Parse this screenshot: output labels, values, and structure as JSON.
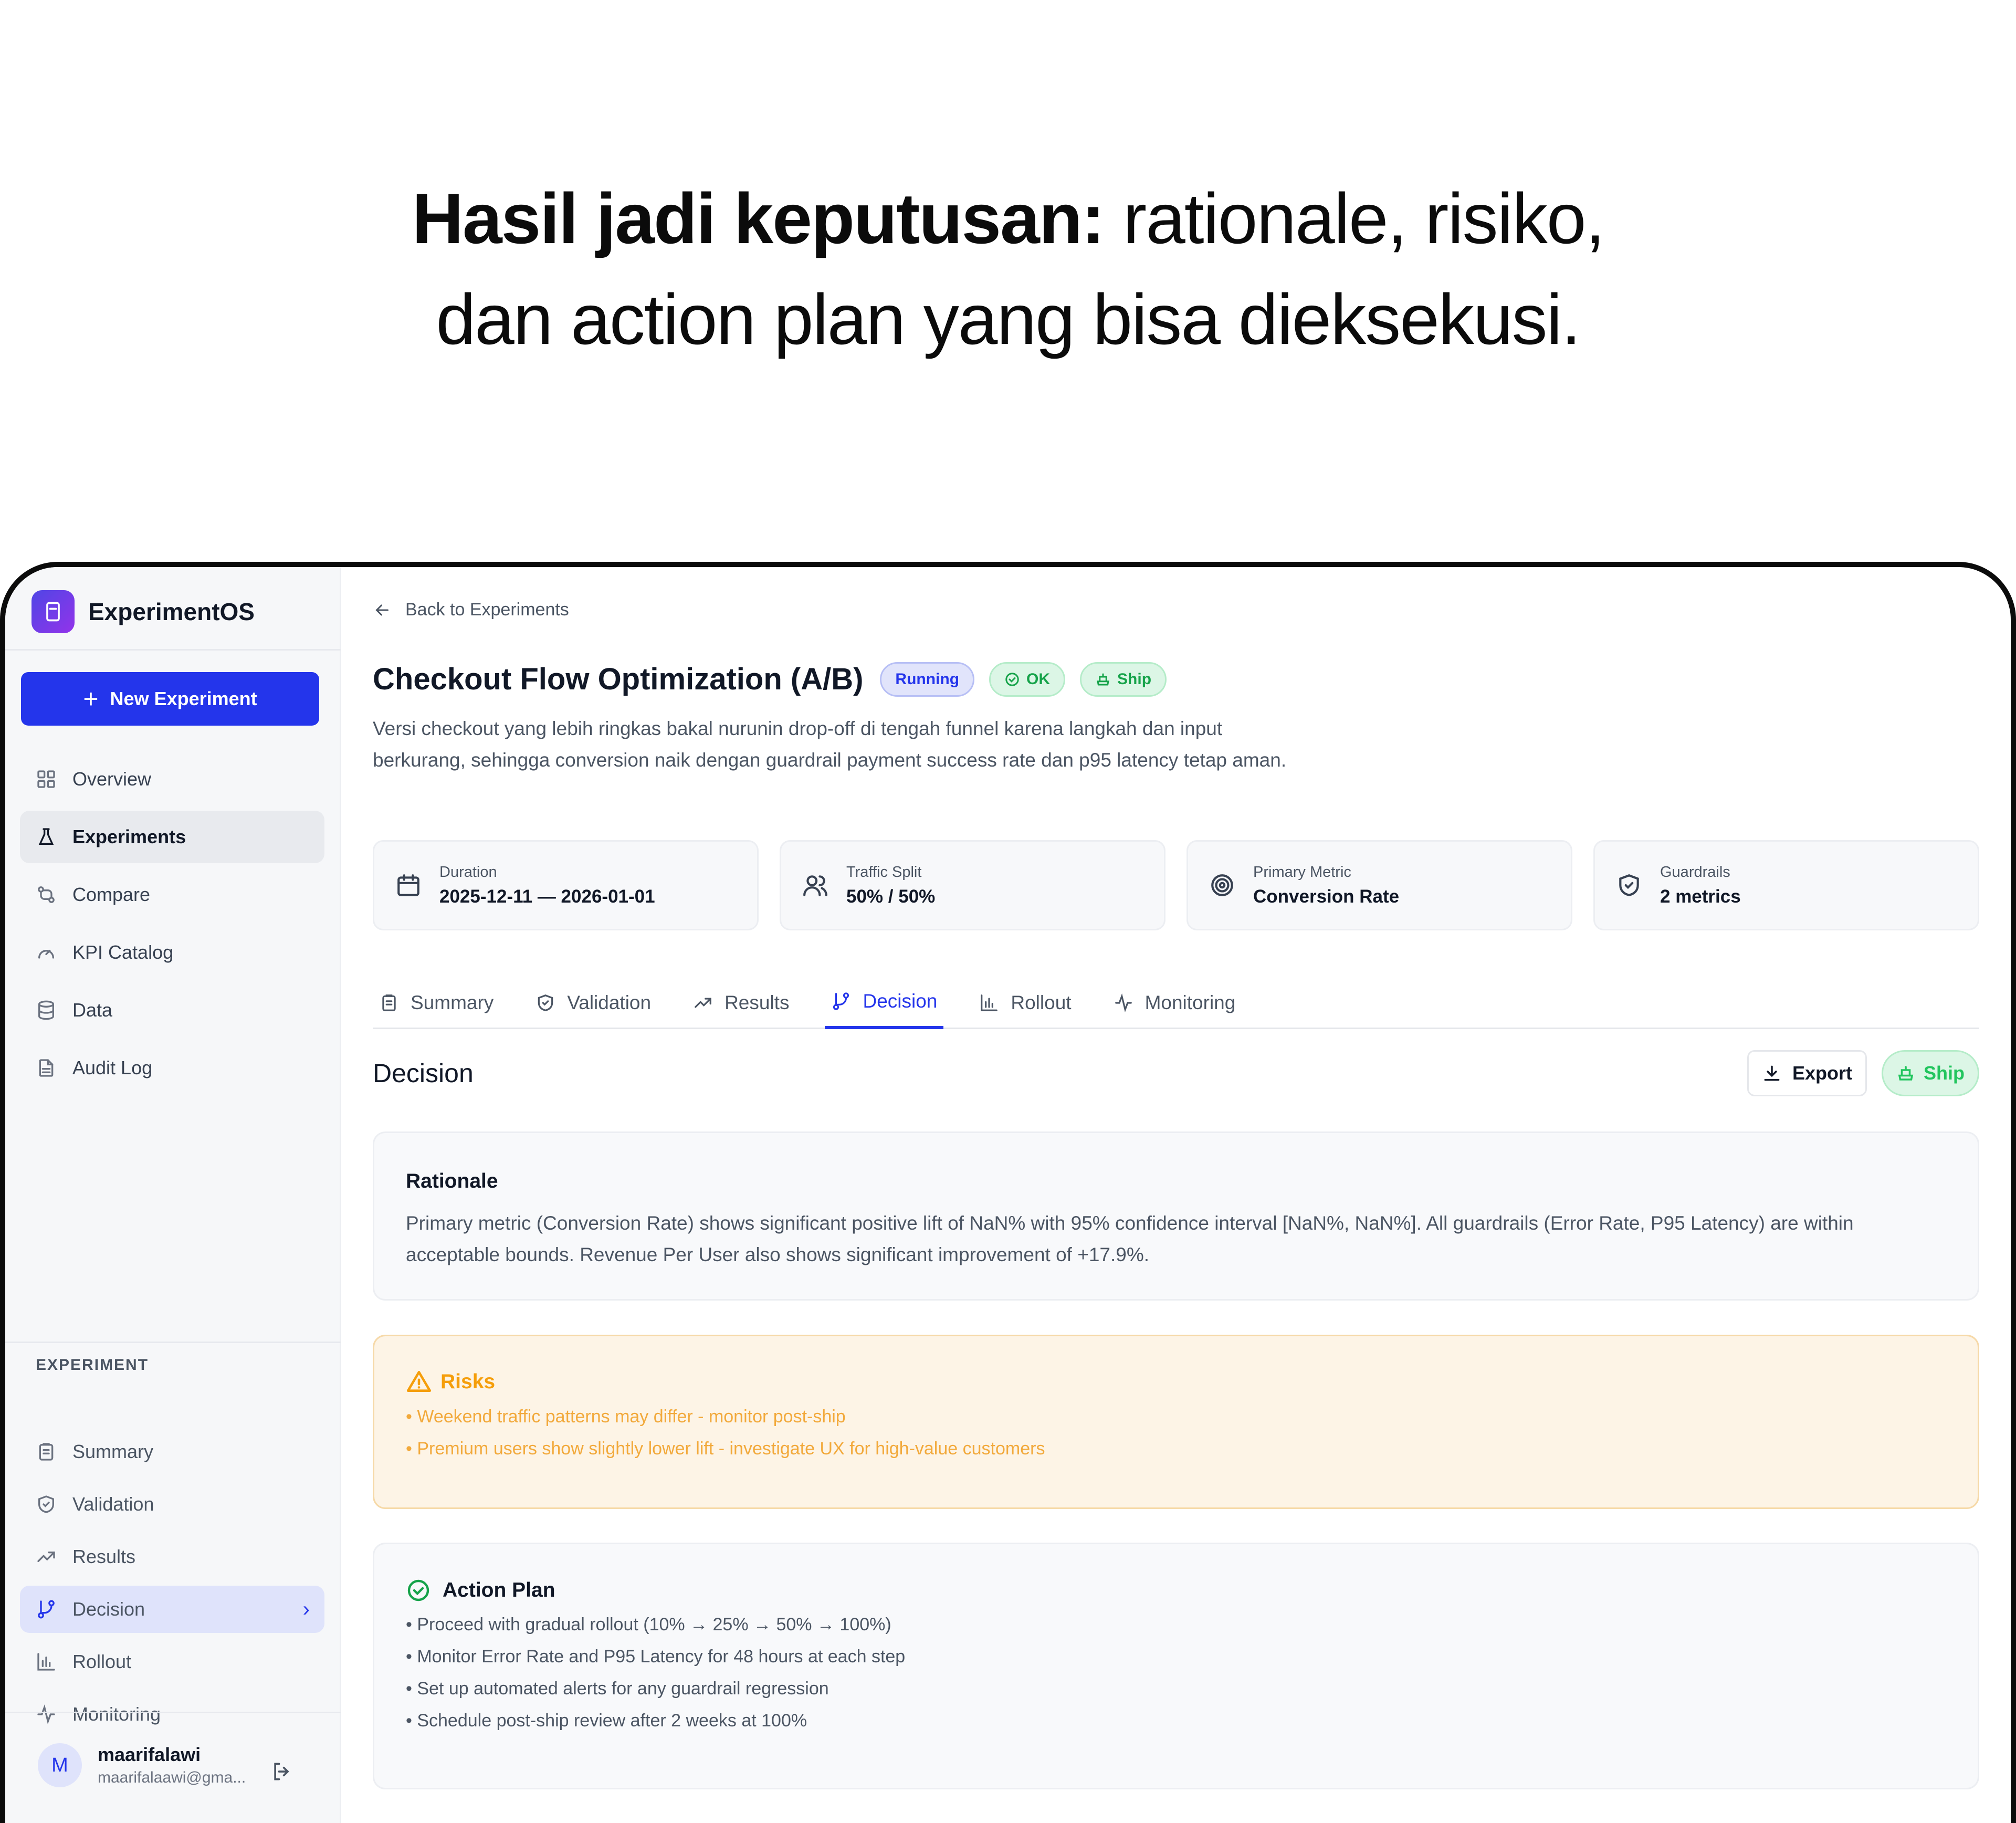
{
  "headline": {
    "bold": "Hasil jadi keputusan:",
    "line1_rest": " rationale, risiko,",
    "line2": "dan action plan yang bisa dieksekusi."
  },
  "sidebar": {
    "brand": "ExperimentOS",
    "new_button": "New Experiment",
    "nav": [
      {
        "label": "Overview",
        "icon": "grid-icon"
      },
      {
        "label": "Experiments",
        "icon": "flask-icon"
      },
      {
        "label": "Compare",
        "icon": "compare-icon"
      },
      {
        "label": "KPI Catalog",
        "icon": "gauge-icon"
      },
      {
        "label": "Data",
        "icon": "database-icon"
      },
      {
        "label": "Audit Log",
        "icon": "document-icon"
      }
    ],
    "section_label": "EXPERIMENT",
    "experiment_nav": [
      {
        "label": "Summary",
        "icon": "clipboard-icon"
      },
      {
        "label": "Validation",
        "icon": "shield-check-icon"
      },
      {
        "label": "Results",
        "icon": "trend-up-icon"
      },
      {
        "label": "Decision",
        "icon": "git-branch-icon"
      },
      {
        "label": "Rollout",
        "icon": "bar-chart-icon"
      },
      {
        "label": "Monitoring",
        "icon": "activity-icon"
      }
    ],
    "user": {
      "initial": "M",
      "name": "maarifalawi",
      "email": "maarifalaawi@gma..."
    }
  },
  "main": {
    "back_label": "Back to Experiments",
    "title": "Checkout Flow Optimization (A/B)",
    "badges": {
      "running": "Running",
      "ok": "OK",
      "ship": "Ship"
    },
    "description": "Versi checkout yang lebih ringkas bakal nurunin drop-off di tengah funnel karena langkah dan input berkurang, sehingga conversion naik dengan guardrail payment success rate dan p95 latency tetap aman.",
    "stats": [
      {
        "label": "Duration",
        "value": "2025-12-11 — 2026-01-01",
        "icon": "calendar-icon"
      },
      {
        "label": "Traffic Split",
        "value": "50% / 50%",
        "icon": "users-icon"
      },
      {
        "label": "Primary Metric",
        "value": "Conversion Rate",
        "icon": "target-icon"
      },
      {
        "label": "Guardrails",
        "value": "2 metrics",
        "icon": "shield-icon"
      }
    ],
    "tabs": [
      "Summary",
      "Validation",
      "Results",
      "Decision",
      "Rollout",
      "Monitoring"
    ],
    "active_tab": "Decision",
    "section_title": "Decision",
    "export_label": "Export",
    "ship_label": "Ship",
    "rationale": {
      "title": "Rationale",
      "text": "Primary metric (Conversion Rate) shows significant positive lift of NaN% with 95% confidence interval [NaN%, NaN%]. All guardrails (Error Rate, P95 Latency) are within acceptable bounds. Revenue Per User also shows significant improvement of +17.9%."
    },
    "risks": {
      "title": "Risks",
      "items": [
        "• Weekend traffic patterns may differ - monitor post-ship",
        "• Premium users show slightly lower lift - investigate UX for high-value customers"
      ]
    },
    "action_plan": {
      "title": "Action Plan",
      "items": [
        "• Proceed with gradual rollout (10% → 25% → 50% → 100%)",
        "• Monitor Error Rate and P95 Latency for 48 hours at each step",
        "• Set up automated alerts for any guardrail regression",
        "• Schedule post-ship review after 2 weeks at 100%"
      ]
    }
  },
  "colors": {
    "accent": "#2435eb",
    "success": "#16a34a",
    "warning": "#f59e0b"
  }
}
